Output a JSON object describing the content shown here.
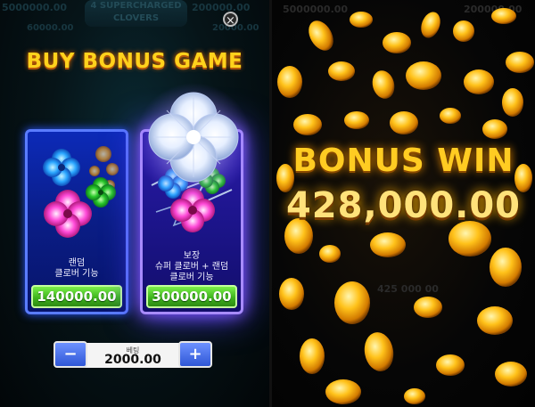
{
  "left_panel": {
    "background_text": {
      "jackpot_top_left": "5000000.00",
      "jackpot_top_right": "200000.00",
      "jackpot_mid_left": "60000.00",
      "jackpot_mid_right": "20000.00",
      "logo_line1": "4 SUPERCHARGED",
      "logo_line2": "CLOVERS"
    },
    "close_icon": "close-icon",
    "title": "BUY BONUS GAME",
    "cards": [
      {
        "description_line1": "랜덤",
        "description_line2": "클로버 기능",
        "price": "140000.00"
      },
      {
        "description_line1": "보장",
        "description_line2": "슈퍼 클로버 + 랜덤",
        "description_line3": "클로버 기능",
        "price": "300000.00"
      }
    ],
    "bet": {
      "label": "베팅",
      "value": "2000.00",
      "minus_label": "−",
      "plus_label": "+"
    }
  },
  "right_panel": {
    "ghost_text": {
      "top_left": "5000000.00",
      "top_right": "200000.00",
      "bottom": "425 000 00"
    },
    "bonus_title": "BONUS WIN",
    "bonus_amount": "428,000.00"
  },
  "colors": {
    "title_gold": "#ffd21c",
    "price_green": "#3fb51d",
    "card_blue": "#0c2ab8",
    "card_purple": "#2a1aa8",
    "coin_gold": "#ffbe1a"
  }
}
